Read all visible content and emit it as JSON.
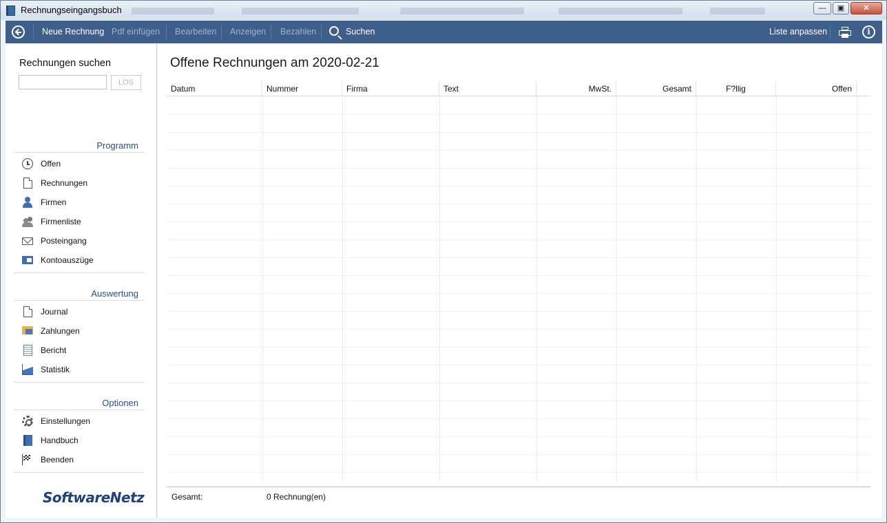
{
  "window": {
    "title": "Rechnungseingangsbuch",
    "minimize_icon": "minimize-icon",
    "maximize_icon": "maximize-icon",
    "close_icon": "close-icon"
  },
  "toolbar": {
    "back_icon": "back-icon",
    "new_invoice": "Neue Rechnung",
    "insert_pdf": "Pdf einfügen",
    "edit": "Bearbeiten",
    "show": "Anzeigen",
    "pay": "Bezahlen",
    "search": "Suchen",
    "customize_list": "Liste anpassen",
    "print_icon": "printer-icon",
    "info_icon": "info-icon"
  },
  "sidebar": {
    "search_title": "Rechnungen suchen",
    "search_value": "",
    "go_button": "LOS",
    "sections": [
      {
        "title": "Programm",
        "items": [
          {
            "label": "Offen",
            "icon": "clock-icon"
          },
          {
            "label": "Rechnungen",
            "icon": "document-icon"
          },
          {
            "label": "Firmen",
            "icon": "person-icon"
          },
          {
            "label": "Firmenliste",
            "icon": "people-icon"
          },
          {
            "label": "Posteingang",
            "icon": "mail-icon"
          },
          {
            "label": "Kontoauszüge",
            "icon": "bank-statement-icon"
          }
        ]
      },
      {
        "title": "Auswertung",
        "items": [
          {
            "label": "Journal",
            "icon": "document-icon"
          },
          {
            "label": "Zahlungen",
            "icon": "payments-icon"
          },
          {
            "label": "Bericht",
            "icon": "report-icon"
          },
          {
            "label": "Statistik",
            "icon": "chart-icon"
          }
        ]
      },
      {
        "title": "Optionen",
        "items": [
          {
            "label": "Einstellungen",
            "icon": "gear-icon"
          },
          {
            "label": "Handbuch",
            "icon": "book-icon"
          },
          {
            "label": "Beenden",
            "icon": "flag-icon"
          }
        ]
      }
    ],
    "logo": "SoftwareNetz"
  },
  "main": {
    "title": "Offene Rechnungen am 2020-02-21",
    "columns": [
      "Datum",
      "Nummer",
      "Firma",
      "Text",
      "MwSt.",
      "Gesamt",
      "F?llig",
      "Offen"
    ],
    "rows": [],
    "footer_label": "Gesamt:",
    "footer_value": "0 Rechnung(en)"
  },
  "colors": {
    "toolbar": "#3e5e8c",
    "section_heading": "#2a4f8a",
    "icon_blue": "#3e6fb4"
  }
}
